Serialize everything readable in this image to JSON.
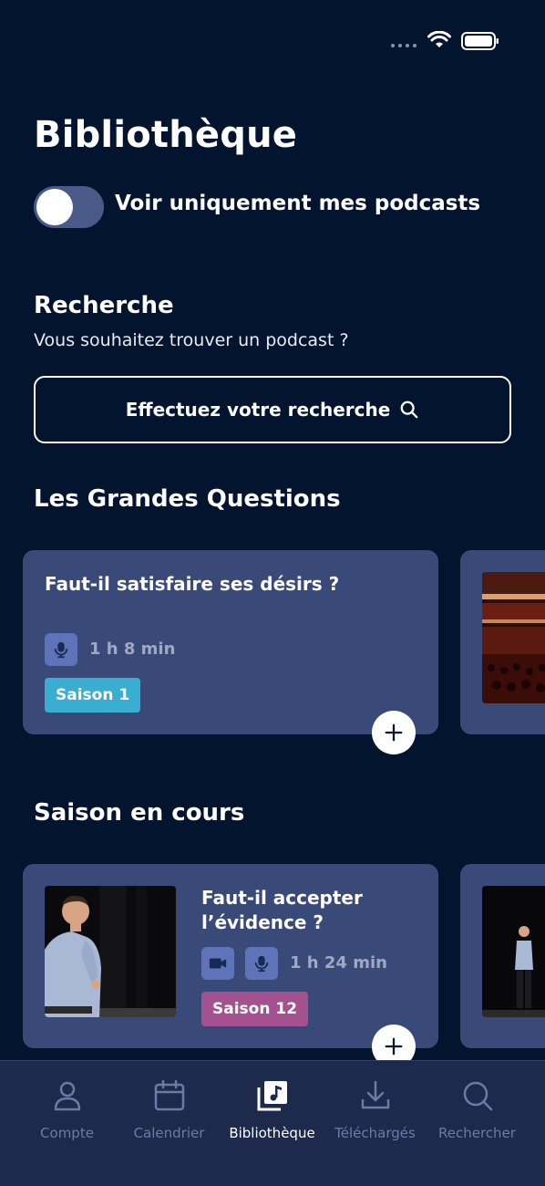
{
  "page": {
    "title": "Bibliothèque"
  },
  "filter": {
    "label": "Voir uniquement mes podcasts",
    "enabled": false
  },
  "search": {
    "title": "Recherche",
    "subtitle": "Vous souhaitez trouver un podcast ?",
    "button_label": "Effectuez votre recherche"
  },
  "grandes_questions": {
    "title": "Les Grandes Questions",
    "cards": [
      {
        "title": "Faut-il satisfaire ses désirs ?",
        "duration": "1 h 8 min",
        "season": "Saison 1",
        "season_color": "#3aaed0",
        "media": [
          "mic-icon"
        ]
      }
    ]
  },
  "saison_en_cours": {
    "title": "Saison en cours",
    "cards": [
      {
        "title_line1": "Faut-il accepter",
        "title_line2": "l’évidence ?",
        "duration": "1 h 24 min",
        "season": "Saison 12",
        "season_color": "#a4528f",
        "media": [
          "video-icon",
          "mic-icon"
        ]
      }
    ]
  },
  "tabs": [
    {
      "label": "Compte",
      "icon": "person-icon",
      "active": false
    },
    {
      "label": "Calendrier",
      "icon": "calendar-icon",
      "active": false
    },
    {
      "label": "Bibliothèque",
      "icon": "library-icon",
      "active": true
    },
    {
      "label": "Téléchargés",
      "icon": "download-icon",
      "active": false
    },
    {
      "label": "Rechercher",
      "icon": "search-icon",
      "active": false
    }
  ],
  "colors": {
    "background": "#03142f",
    "card": "#3a4a78",
    "tab_bar": "#1d2a4c",
    "inactive_tab": "#6c7ba6"
  }
}
